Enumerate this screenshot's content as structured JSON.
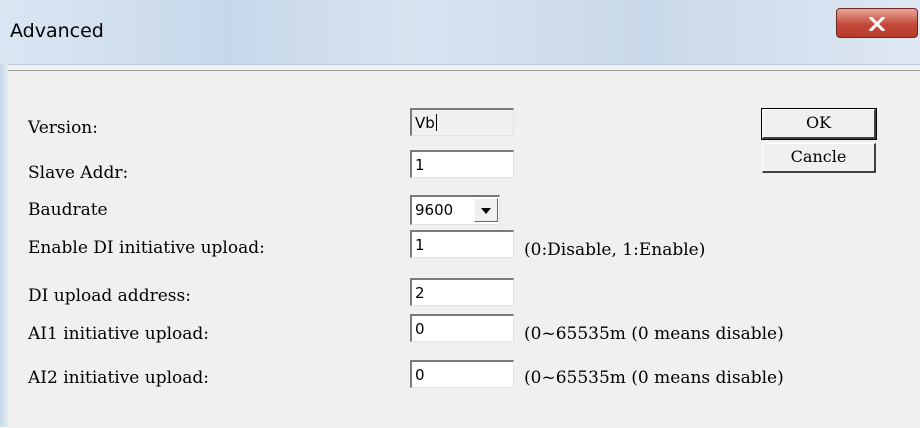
{
  "window": {
    "title": "Advanced"
  },
  "buttons": {
    "ok": "OK",
    "cancel": "Cancle"
  },
  "form": {
    "version": {
      "label": "Version:",
      "value": "Vb"
    },
    "slave_addr": {
      "label": "Slave Addr:",
      "value": "1"
    },
    "baudrate": {
      "label": "Baudrate",
      "value": "9600"
    },
    "enable_di": {
      "label": "Enable DI initiative upload:",
      "value": "1",
      "hint": "(0:Disable, 1:Enable)"
    },
    "di_address": {
      "label": "DI upload address:",
      "value": "2"
    },
    "ai1": {
      "label": "AI1 initiative upload:",
      "value": "0",
      "hint": "(0~65535m (0 means disable)"
    },
    "ai2": {
      "label": "AI2 initiative upload:",
      "value": "0",
      "hint": "(0~65535m (0 means disable)"
    }
  },
  "icons": {
    "close": "close-icon",
    "dropdown": "chevron-down-icon"
  },
  "colors": {
    "close_button": "#c4493a",
    "dialog_bg": "#f0f0f0"
  }
}
